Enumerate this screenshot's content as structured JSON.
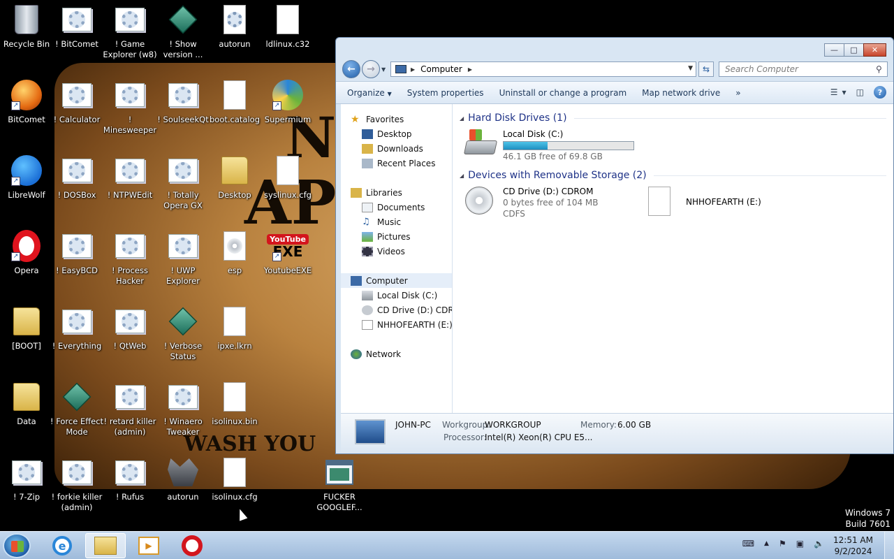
{
  "desktop": {
    "wallpaper_text": [
      "N",
      "AP",
      "WASH YOU"
    ],
    "icons": [
      {
        "label": "Recycle Bin",
        "icon": "recycle-bin-icon"
      },
      {
        "label": "! BitComet",
        "icon": "settings-gear-icon"
      },
      {
        "label": "! Game Explorer (w8)",
        "icon": "settings-gear-icon"
      },
      {
        "label": "! Show version ...",
        "icon": "registry-cube-icon"
      },
      {
        "label": "autorun",
        "icon": "gear-document-icon"
      },
      {
        "label": "ldlinux.c32",
        "icon": "file-icon"
      },
      {
        "label": "BitComet",
        "icon": "bitcomet-icon"
      },
      {
        "label": "! Calculator",
        "icon": "settings-gear-icon"
      },
      {
        "label": "! Minesweeper",
        "icon": "settings-gear-icon"
      },
      {
        "label": "! SoulseekQt",
        "icon": "settings-gear-icon"
      },
      {
        "label": "boot.catalog",
        "icon": "file-icon"
      },
      {
        "label": "Supermium",
        "icon": "supermium-icon"
      },
      {
        "label": "LibreWolf",
        "icon": "librewolf-icon"
      },
      {
        "label": "! DOSBox",
        "icon": "settings-gear-icon"
      },
      {
        "label": "! NTPWEdit",
        "icon": "settings-gear-icon"
      },
      {
        "label": "! Totally Opera GX",
        "icon": "settings-gear-icon"
      },
      {
        "label": "Desktop",
        "icon": "folder-icon"
      },
      {
        "label": "syslinux.cfg",
        "icon": "file-icon"
      },
      {
        "label": "Opera",
        "icon": "opera-icon"
      },
      {
        "label": "! EasyBCD",
        "icon": "settings-gear-icon"
      },
      {
        "label": "! Process Hacker",
        "icon": "settings-gear-icon"
      },
      {
        "label": "! UWP Explorer",
        "icon": "settings-gear-icon"
      },
      {
        "label": "esp",
        "icon": "disc-image-icon"
      },
      {
        "label": "YoutubeEXE",
        "icon": "youtube-icon"
      },
      {
        "label": "[BOOT]",
        "icon": "folder-icon"
      },
      {
        "label": "! Everything",
        "icon": "settings-gear-icon"
      },
      {
        "label": "! QtWeb",
        "icon": "settings-gear-icon"
      },
      {
        "label": "! Verbose Status",
        "icon": "registry-cube-icon"
      },
      {
        "label": "ipxe.lkrn",
        "icon": "file-icon"
      },
      {
        "label": "Data",
        "icon": "folder-icon"
      },
      {
        "label": "! Force Effect Mode",
        "icon": "registry-cube-icon"
      },
      {
        "label": "! retard killer (admin)",
        "icon": "settings-gear-icon"
      },
      {
        "label": "! Winaero Tweaker",
        "icon": "settings-gear-icon"
      },
      {
        "label": "isolinux.bin",
        "icon": "file-icon"
      },
      {
        "label": "! 7-Zip",
        "icon": "settings-gear-icon"
      },
      {
        "label": "! forkie killer (admin)",
        "icon": "settings-gear-icon"
      },
      {
        "label": "! Rufus",
        "icon": "settings-gear-icon"
      },
      {
        "label": "autorun",
        "icon": "wolf-icon"
      },
      {
        "label": "isolinux.cfg",
        "icon": "file-icon"
      },
      {
        "label": "FUCKER GOOGLEF...",
        "icon": "program-window-icon"
      }
    ],
    "watermark": [
      "Windows 7",
      "Build 7601"
    ]
  },
  "explorer": {
    "address": {
      "path": "Computer"
    },
    "search": {
      "placeholder": "Search Computer"
    },
    "commands": [
      "Organize",
      "System properties",
      "Uninstall or change a program",
      "Map network drive"
    ],
    "more": "»",
    "nav": {
      "favorites": {
        "label": "Favorites",
        "items": [
          "Desktop",
          "Downloads",
          "Recent Places"
        ]
      },
      "libraries": {
        "label": "Libraries",
        "items": [
          "Documents",
          "Music",
          "Pictures",
          "Videos"
        ]
      },
      "computer": {
        "label": "Computer",
        "items": [
          "Local Disk (C:)",
          "CD Drive (D:) CDROM",
          "NHHOFEARTH (E:)"
        ]
      },
      "network": {
        "label": "Network"
      }
    },
    "groups": {
      "hdd": "Hard Disk Drives (1)",
      "removable": "Devices with Removable Storage (2)"
    },
    "drives": {
      "c": {
        "name": "Local Disk (C:)",
        "free": "46.1 GB free of 69.8 GB",
        "used_fraction": 0.34
      },
      "d": {
        "name": "CD Drive (D:) CDROM",
        "free": "0 bytes free of 104 MB",
        "fs": "CDFS"
      },
      "e": {
        "name": "NHHOFEARTH (E:)"
      }
    },
    "details": {
      "name": "JOHN-PC",
      "workgroup_label": "Workgroup:",
      "workgroup": "WORKGROUP",
      "memory_label": "Memory:",
      "memory": "6.00 GB",
      "processor_label": "Processor:",
      "processor": "Intel(R) Xeon(R) CPU E5..."
    }
  },
  "taskbar": {
    "clock": {
      "time": "12:51 AM",
      "date": "9/2/2024"
    }
  }
}
